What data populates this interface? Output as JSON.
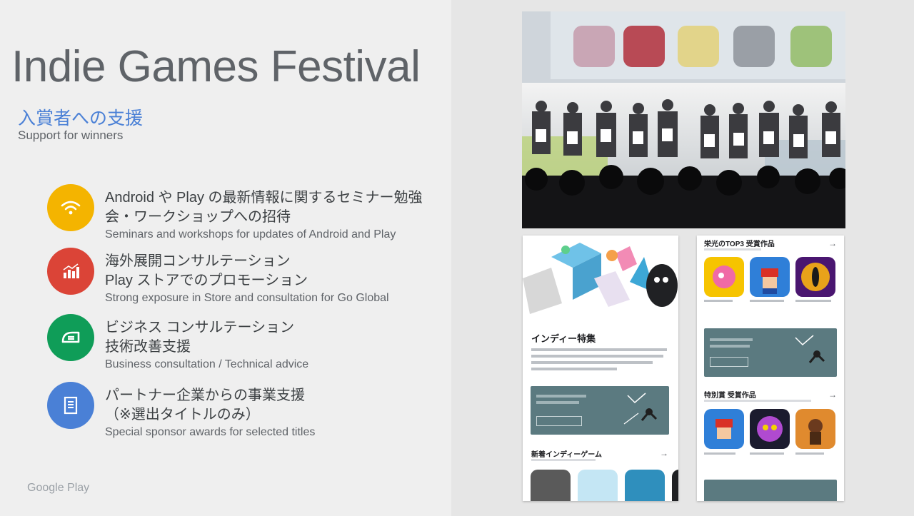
{
  "slide": {
    "title": "Indie Games Festival",
    "subtitle_jp": "入賞者への支援",
    "subtitle_en": "Support for winners",
    "brand": "Google Play"
  },
  "features": [
    {
      "icon": "wifi-icon",
      "color": "#f4b400",
      "jp_lines": [
        "Android や Play の最新情報に関するセミナー勉強",
        "会・ワークショップへの招待"
      ],
      "en": "Seminars and workshops for updates of Android and Play"
    },
    {
      "icon": "chart-icon",
      "color": "#db4437",
      "jp_lines": [
        "海外展開コンサルテーション",
        "Play ストアでのプロモーション"
      ],
      "en": "Strong exposure in Store and consultation for Go Global"
    },
    {
      "icon": "speed-icon",
      "color": "#0f9d58",
      "jp_lines": [
        "ビジネス コンサルテーション",
        "技術改善支援"
      ],
      "en": "Business consultation / Technical advice"
    },
    {
      "icon": "document-icon",
      "color": "#4a80d6",
      "jp_lines": [
        "パートナー企業からの事業支援",
        "（※選出タイトルのみ）"
      ],
      "en": "Special sponsor awards for selected titles"
    }
  ],
  "phone1": {
    "section_title": "インディー特集",
    "section2_title": "新着インディーゲーム"
  },
  "phone2": {
    "section_title": "栄光のTOP3 受賞作品",
    "section2_title": "特別賞 受賞作品"
  },
  "colors": {
    "accent_blue": "#4a80d6",
    "title_gray": "#5f6368",
    "card_teal": "#5b7a80"
  }
}
